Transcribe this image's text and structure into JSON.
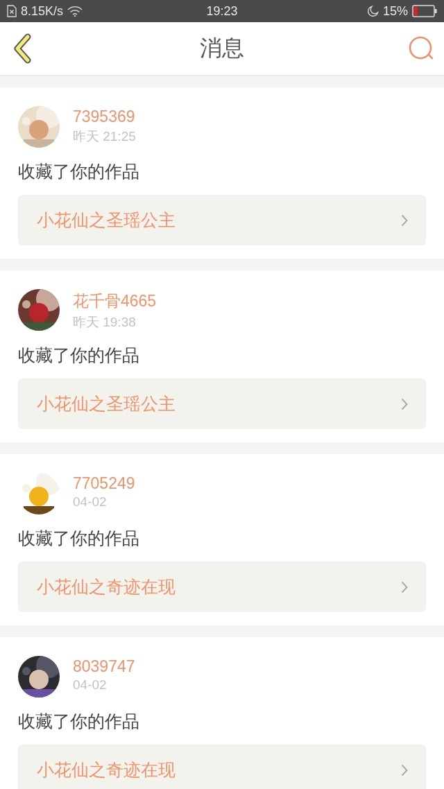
{
  "status_bar": {
    "speed": "8.15K/s",
    "time": "19:23",
    "battery": "15%"
  },
  "header": {
    "title": "消息"
  },
  "messages": [
    {
      "user": "7395369",
      "time": "昨天 21:25",
      "action": "收藏了你的作品",
      "work": "小花仙之圣瑶公主"
    },
    {
      "user": "花千骨4665",
      "time": "昨天 19:38",
      "action": "收藏了你的作品",
      "work": "小花仙之圣瑶公主"
    },
    {
      "user": "7705249",
      "time": "04-02",
      "action": "收藏了你的作品",
      "work": "小花仙之奇迹在现"
    },
    {
      "user": "8039747",
      "time": "04-02",
      "action": "收藏了你的作品",
      "work": "小花仙之奇迹在现"
    }
  ]
}
